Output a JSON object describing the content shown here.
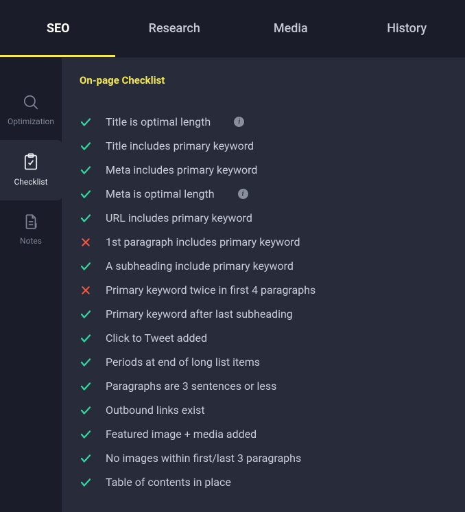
{
  "tabs": [
    {
      "label": "SEO",
      "active": true
    },
    {
      "label": "Research",
      "active": false
    },
    {
      "label": "Media",
      "active": false
    },
    {
      "label": "History",
      "active": false
    }
  ],
  "sidebar": [
    {
      "id": "optimization",
      "label": "Optimization",
      "icon": "search-icon",
      "active": false
    },
    {
      "id": "checklist",
      "label": "Checklist",
      "icon": "clipboard-check-icon",
      "active": true
    },
    {
      "id": "notes",
      "label": "Notes",
      "icon": "document-icon",
      "active": false
    }
  ],
  "main": {
    "title": "On-page Checklist",
    "items": [
      {
        "status": "pass",
        "label": "Title is optimal length",
        "info": true
      },
      {
        "status": "pass",
        "label": "Title includes primary keyword",
        "info": false
      },
      {
        "status": "pass",
        "label": "Meta includes primary keyword",
        "info": false
      },
      {
        "status": "pass",
        "label": "Meta is optimal length",
        "info": true
      },
      {
        "status": "pass",
        "label": "URL includes primary keyword",
        "info": false
      },
      {
        "status": "fail",
        "label": "1st paragraph includes primary keyword",
        "info": false
      },
      {
        "status": "pass",
        "label": "A subheading include primary keyword",
        "info": false
      },
      {
        "status": "fail",
        "label": "Primary keyword twice in first 4 paragraphs",
        "info": false
      },
      {
        "status": "pass",
        "label": "Primary keyword after last subheading",
        "info": false
      },
      {
        "status": "pass",
        "label": "Click to Tweet added",
        "info": false
      },
      {
        "status": "pass",
        "label": "Periods at end of long list items",
        "info": false
      },
      {
        "status": "pass",
        "label": "Paragraphs are 3 sentences or less",
        "info": false
      },
      {
        "status": "pass",
        "label": "Outbound links exist",
        "info": false
      },
      {
        "status": "pass",
        "label": "Featured image + media added",
        "info": false
      },
      {
        "status": "pass",
        "label": "No images within first/last 3 paragraphs",
        "info": false
      },
      {
        "status": "pass",
        "label": "Table of contents in place",
        "info": false
      }
    ]
  },
  "colors": {
    "pass": "#2fd89f",
    "fail": "#ff5a3d",
    "accent": "#f5e94e"
  }
}
